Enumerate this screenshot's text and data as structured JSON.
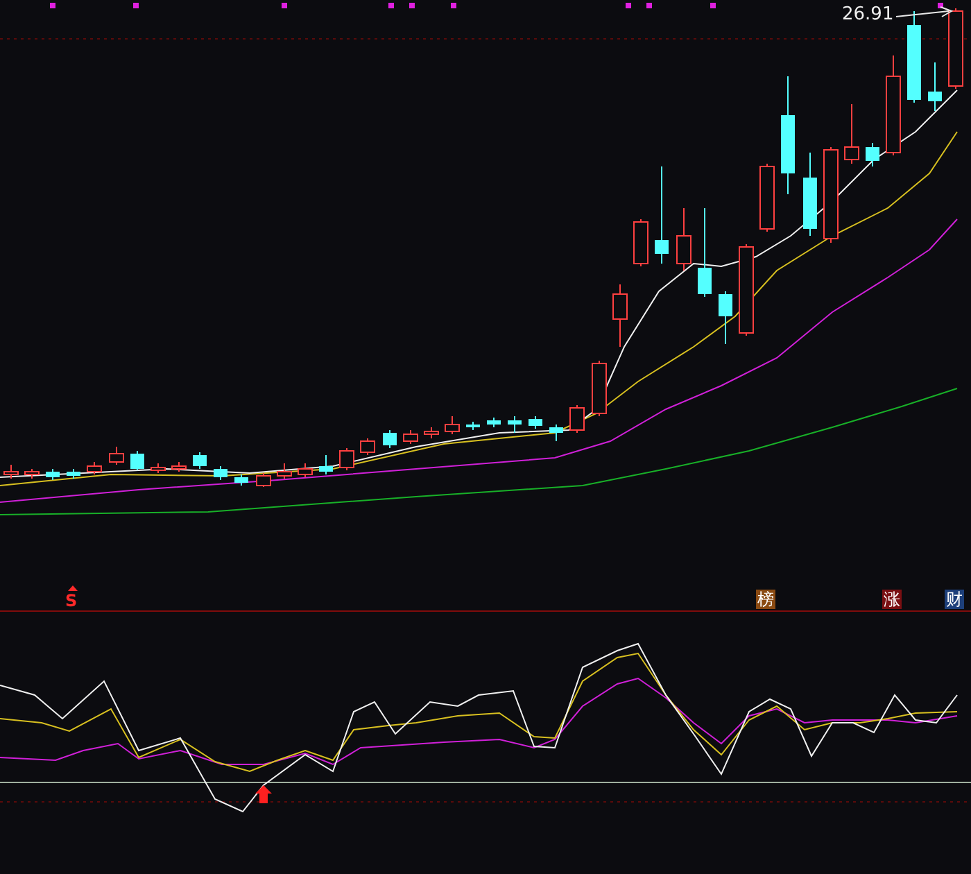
{
  "price_chart": {
    "high_label": "26.91"
  },
  "signal_marks": [
    {
      "text": "S",
      "kind": "sell"
    }
  ],
  "badges": [
    {
      "text": "榜",
      "color": "#8a4a12"
    },
    {
      "text": "涨",
      "color": "#7a0f12"
    },
    {
      "text": "财",
      "color": "#1d3f7a"
    }
  ]
}
